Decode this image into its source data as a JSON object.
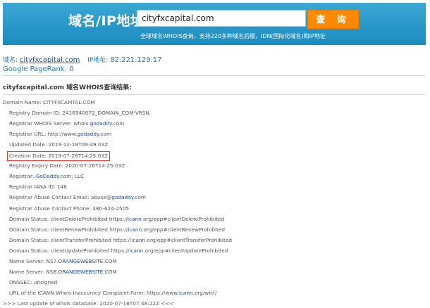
{
  "header": {
    "title": "域名/IP地址:",
    "search_value": "cityfxcapital.com",
    "search_button": "查 询",
    "subtitle": "全球域名WHOIS查询，支持220多种域名后缀，IDN(国际化域名)和IP地址"
  },
  "info": {
    "domain_label": "域名:",
    "domain_value": "cityfxcapital.com",
    "ip_label": "IP地址:",
    "ip_value": "82.221.129.17",
    "pagerank": "Google PageRank: 0"
  },
  "result_title": "cityfxcapital.com 域名WHOIS查询结果:",
  "whois": [
    {
      "text": "Domain Name: CITYFXCAPITAL.COM"
    },
    {
      "text": "Registry Domain ID: 2416940072_DOMAIN_COM-VRSN"
    },
    {
      "pre": "Registrar WHOIS Server: whois.",
      "link": "godaddy",
      "post": ".com"
    },
    {
      "pre": "Registrar URL: http://www.",
      "link": "godaddy",
      "post": ".com"
    },
    {
      "text": "Updated Date: 2019-12-18T09:49:03Z"
    },
    {
      "text": "Creation Date: 2019-07-26T14:25:03Z",
      "highlight": "true"
    },
    {
      "text": "Registry Expiry Date: 2020-07-26T14:25:03Z"
    },
    {
      "pre": "Registrar: ",
      "link": "GoDaddy",
      "post": ".com, LLC"
    },
    {
      "text": "Registrar IANA ID: 146"
    },
    {
      "pre": "Registrar Abuse Contact Email: abuse@",
      "link": "godaddy",
      "post": ".com"
    },
    {
      "text": "Registrar Abuse Contact Phone: 480-624-2505"
    },
    {
      "pre": "Domain Status: clientDeleteProhibited https://",
      "link": "icann",
      "post": ".org/epp#clientDeleteProhibited"
    },
    {
      "pre": "Domain Status: clientRenewProhibited https://",
      "link": "icann",
      "post": ".org/epp#clientRenewProhibited"
    },
    {
      "pre": "Domain Status: clientTransferProhibited https://",
      "link": "icann",
      "post": ".org/epp#clientTransferProhibited"
    },
    {
      "pre": "Domain Status: clientUpdateProhibited https://",
      "link": "icann",
      "post": ".org/epp#clientUpdateProhibited"
    },
    {
      "pre": "Name Server: NS7.",
      "link": "ORANGEWEBSITE",
      "post": ".COM"
    },
    {
      "pre": "Name Server: NS8.",
      "link": "ORANGEWEBSITE",
      "post": ".COM"
    },
    {
      "text": "DNSSEC: unsigned"
    },
    {
      "pre": "URL of the ICANN Whois Inaccuracy Complaint Form: https://www.",
      "link": "icann",
      "post": ".org/wicf/"
    },
    {
      "text": ">>> Last update of whois database: 2020-07-16T07:48:22Z <<<",
      "outdent": "true"
    }
  ]
}
